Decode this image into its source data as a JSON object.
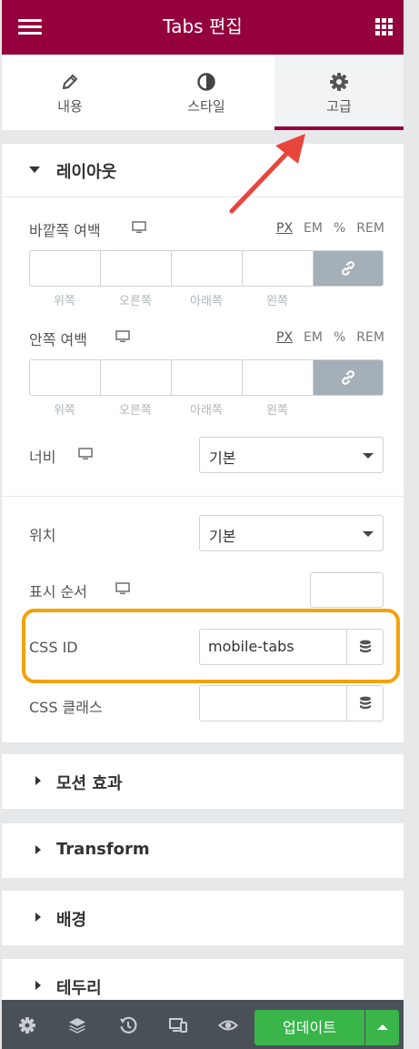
{
  "header": {
    "title": "Tabs 편집"
  },
  "tabs": [
    {
      "label": "내용",
      "icon": "pencil-icon"
    },
    {
      "label": "스타일",
      "icon": "contrast-icon"
    },
    {
      "label": "고급",
      "icon": "gear-icon",
      "active": true
    }
  ],
  "layout_section": {
    "title": "레이아웃",
    "margin": {
      "label": "바깥쪽 여백",
      "units": [
        "PX",
        "EM",
        "%",
        "REM"
      ],
      "selected_unit": "PX",
      "fields": [
        "위쪽",
        "오른쪽",
        "아래쪽",
        "왼쪽"
      ]
    },
    "padding": {
      "label": "안쪽 여백",
      "units": [
        "PX",
        "EM",
        "%",
        "REM"
      ],
      "selected_unit": "PX",
      "fields": [
        "위쪽",
        "오른쪽",
        "아래쪽",
        "왼쪽"
      ]
    },
    "width": {
      "label": "너비",
      "value": "기본"
    },
    "position": {
      "label": "위치",
      "value": "기본"
    },
    "order": {
      "label": "표시 순서",
      "value": ""
    },
    "css_id": {
      "label": "CSS ID",
      "value": "mobile-tabs"
    },
    "css_classes": {
      "label": "CSS 클래스",
      "value": ""
    }
  },
  "collapsed_sections": [
    "모션 효과",
    "Transform",
    "배경",
    "테두리"
  ],
  "footer": {
    "update_label": "업데이트"
  },
  "colors": {
    "brand": "#93003c",
    "highlight": "#f5a10a",
    "arrow": "#e8453c",
    "update": "#39b54a",
    "footer": "#495157"
  }
}
